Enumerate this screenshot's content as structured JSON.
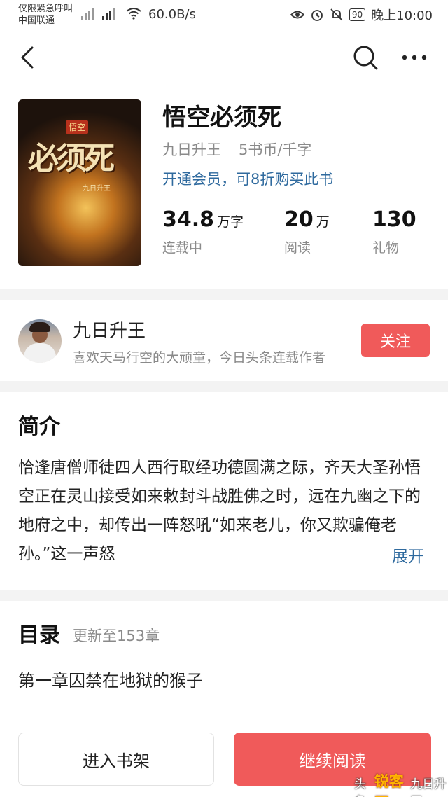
{
  "status_bar": {
    "carrier_line1": "仅限紧急呼叫",
    "carrier_line2": "中国联通",
    "net_speed": "60.0B/s",
    "battery": "90",
    "time": "晚上10:00"
  },
  "nav": {
    "back_icon": "chevron-left-icon",
    "search_icon": "search-icon",
    "more_icon": "more-horizontal-icon"
  },
  "book": {
    "title": "悟空必须死",
    "author": "九日升王",
    "price": "5书币/千字",
    "vip_offer": "开通会员，可8折购买此书",
    "cover": {
      "badge": "悟空",
      "title": "必须死",
      "author": "九日升王"
    },
    "stats": [
      {
        "value": "34.8",
        "unit": "万字",
        "label": "连载中"
      },
      {
        "value": "20",
        "unit": "万",
        "label": "阅读"
      },
      {
        "value": "130",
        "unit": "",
        "label": "礼物"
      }
    ]
  },
  "author_card": {
    "name": "九日升王",
    "bio": "喜欢天马行空的大顽童，今日头条连载作者",
    "follow_label": "关注"
  },
  "intro": {
    "heading": "简介",
    "text": "恰逢唐僧师徒四人西行取经功德圆满之际，齐天大圣孙悟空正在灵山接受如来敕封斗战胜佛之时，远在九幽之下的地府之中，却传出一阵怒吼“如来老儿，你又欺骗俺老孙。”这一声怒",
    "expand_label": "展开"
  },
  "toc": {
    "heading": "目录",
    "update_info": "更新至153章",
    "first_chapter": "第一章囚禁在地狱的猴子"
  },
  "bottom_bar": {
    "shelf_label": "进入书架",
    "read_label": "继续阅读"
  },
  "watermark": {
    "prefix": "头条",
    "brand": "锐客网",
    "suffix": "九日升王"
  },
  "colors": {
    "accent_red": "#f05a5a",
    "link_blue": "#2f6a9e",
    "muted_gray": "#8a8a8a"
  }
}
